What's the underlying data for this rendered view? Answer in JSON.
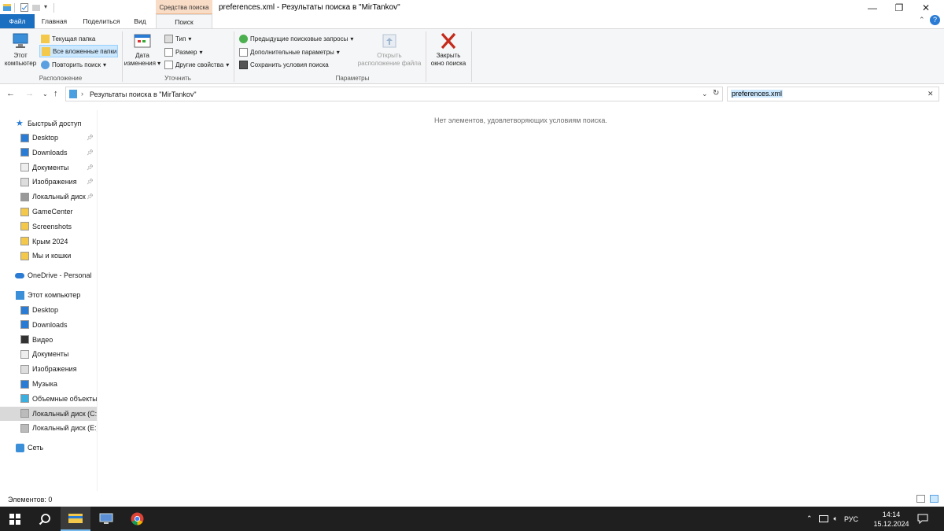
{
  "window": {
    "title": "preferences.xml - Результаты поиска в \"MirTankov\"",
    "contextual_header": "Средства поиска",
    "controls": {
      "minimize": "—",
      "maximize": "❐",
      "close": "✕"
    },
    "help": "?"
  },
  "tabs": {
    "file": "Файл",
    "home": "Главная",
    "share": "Поделиться",
    "view": "Вид",
    "search": "Поиск"
  },
  "ribbon": {
    "location": {
      "this_pc": "Этот компьютер",
      "this_pc_line1": "Этот",
      "this_pc_line2": "компьютер",
      "current_folder": "Текущая папка",
      "all_subfolders": "Все вложенные папки",
      "repeat_search": "Повторить поиск",
      "label": "Расположение"
    },
    "refine": {
      "date_line1": "Дата",
      "date_line2": "изменения",
      "type": "Тип",
      "size": "Размер",
      "other_properties": "Другие свойства",
      "label": "Уточнить"
    },
    "options": {
      "recent_searches": "Предыдущие поисковые запросы",
      "advanced_options": "Дополнительные параметры",
      "save_search": "Сохранить условия поиска",
      "open_location_line1": "Открыть",
      "open_location_line2": "расположение файла",
      "close_search_line1": "Закрыть",
      "close_search_line2": "окно поиска",
      "label": "Параметры"
    }
  },
  "address": {
    "path": "Результаты поиска в \"MirTankov\"",
    "separator": "›"
  },
  "search": {
    "value": "preferences.xml",
    "clear": "✕"
  },
  "nav": {
    "quick_access": "Быстрый доступ",
    "qa_items": [
      {
        "label": "Desktop",
        "pinned": true
      },
      {
        "label": "Downloads",
        "pinned": true
      },
      {
        "label": "Документы",
        "pinned": true
      },
      {
        "label": "Изображения",
        "pinned": true
      },
      {
        "label": "Локальный диск",
        "pinned": true
      },
      {
        "label": "GameCenter",
        "pinned": false
      },
      {
        "label": "Screenshots",
        "pinned": false
      },
      {
        "label": "Крым 2024",
        "pinned": false
      },
      {
        "label": "Мы и кошки",
        "pinned": false
      }
    ],
    "onedrive": "OneDrive - Personal",
    "this_pc": "Этот компьютер",
    "pc_items": [
      "Desktop",
      "Downloads",
      "Видео",
      "Документы",
      "Изображения",
      "Музыка",
      "Объемные объекты",
      "Локальный диск (C:)",
      "Локальный диск (E:)"
    ],
    "network": "Сеть"
  },
  "main": {
    "empty_message": "Нет элементов, удовлетворяющих условиям поиска."
  },
  "status": {
    "items_count": "Элементов: 0"
  },
  "taskbar": {
    "language": "РУС",
    "time": "14:14",
    "date": "15.12.2024"
  },
  "colors": {
    "file_tab": "#1a6fc0",
    "contextual": "#f9dcc6",
    "taskbar": "#1f1f1f",
    "selection": "#cce8ff"
  }
}
